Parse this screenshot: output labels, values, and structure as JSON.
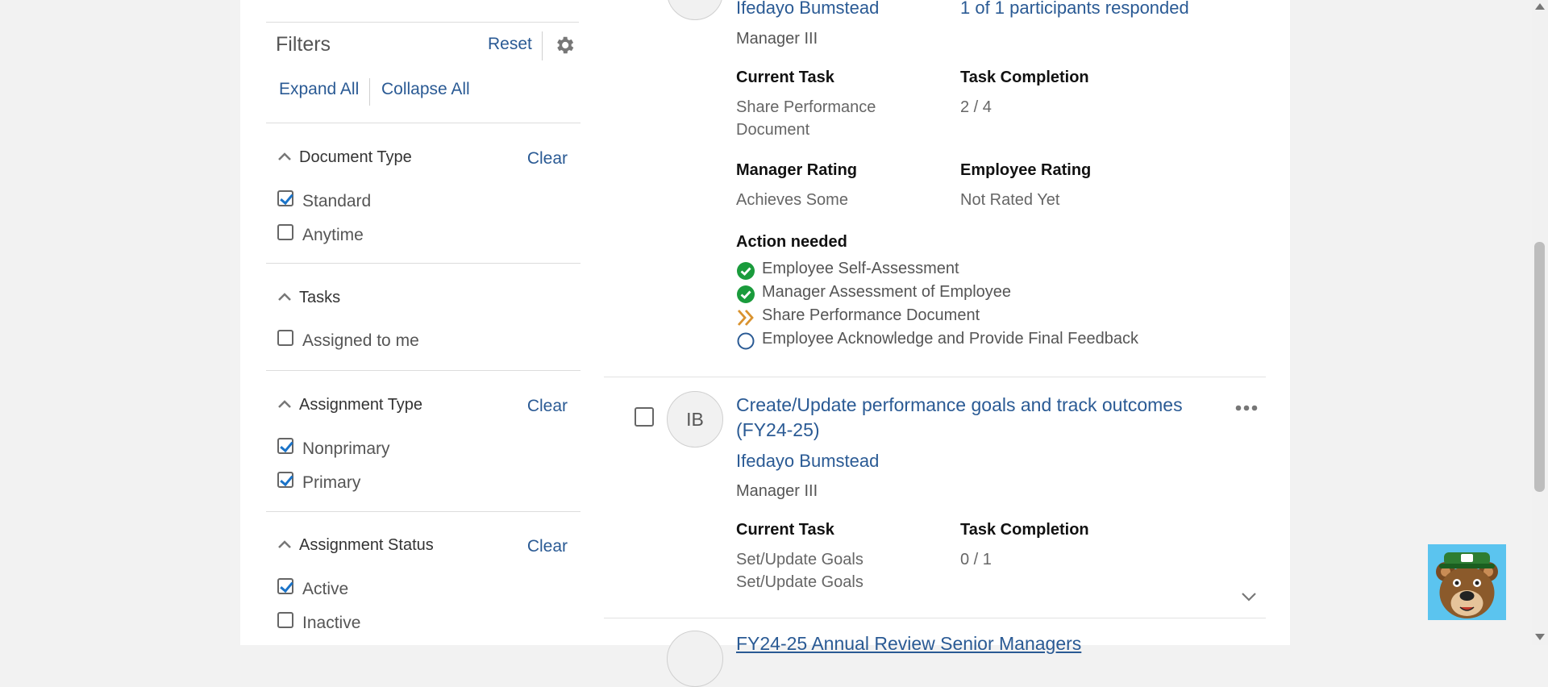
{
  "filters": {
    "title": "Filters",
    "reset_label": "Reset",
    "settings_icon": "gear-icon",
    "expand_all_label": "Expand All",
    "collapse_all_label": "Collapse All",
    "sections": [
      {
        "title": "Document Type",
        "clear_label": "Clear",
        "options": [
          {
            "label": "Standard",
            "checked": true
          },
          {
            "label": "Anytime",
            "checked": false
          }
        ]
      },
      {
        "title": "Tasks",
        "options": [
          {
            "label": "Assigned to me",
            "checked": false
          }
        ]
      },
      {
        "title": "Assignment Type",
        "clear_label": "Clear",
        "options": [
          {
            "label": "Nonprimary",
            "checked": true
          },
          {
            "label": "Primary",
            "checked": true
          }
        ]
      },
      {
        "title": "Assignment Status",
        "clear_label": "Clear",
        "options": [
          {
            "label": "Active",
            "checked": true
          },
          {
            "label": "Inactive",
            "checked": false
          }
        ]
      }
    ]
  },
  "cards": [
    {
      "person_name": "Ifedayo Bumstead",
      "response_status": "1 of 1 participants responded",
      "role": "Manager III",
      "current_task_label": "Current Task",
      "current_task_line1": "Share Performance",
      "current_task_line2": "Document",
      "task_completion_label": "Task Completion",
      "task_completion_value": "2 / 4",
      "manager_rating_label": "Manager Rating",
      "manager_rating_value": "Achieves Some",
      "employee_rating_label": "Employee Rating",
      "employee_rating_value": "Not Rated Yet",
      "action_needed_label": "Action needed",
      "actions": [
        {
          "text": "Employee Self-Assessment",
          "status": "completed",
          "icon": "check-circle-icon"
        },
        {
          "text": "Manager Assessment of Employee",
          "status": "completed",
          "icon": "check-circle-icon"
        },
        {
          "text": "Share Performance Document",
          "status": "current",
          "icon": "double-chevron-right-icon"
        },
        {
          "text": "Employee Acknowledge and Provide Final Feedback",
          "status": "pending",
          "icon": "empty-circle-icon"
        }
      ]
    },
    {
      "avatar_initials": "IB",
      "title_line1": "Create/Update performance goals and track outcomes",
      "title_line2": "(FY24-25)",
      "person_name": "Ifedayo Bumstead",
      "role": "Manager III",
      "current_task_label": "Current Task",
      "current_task_line1": "Set/Update Goals",
      "current_task_line2": "Set/Update Goals",
      "task_completion_label": "Task Completion",
      "task_completion_value": "0 / 1"
    },
    {
      "title_line1": "FY24-25 Annual Review Senior Managers"
    }
  ],
  "colors": {
    "link": "#2a5a94",
    "check_green": "#1a9b3c",
    "current_orange": "#d9922e",
    "checkbox_blue": "#1a73c8"
  }
}
